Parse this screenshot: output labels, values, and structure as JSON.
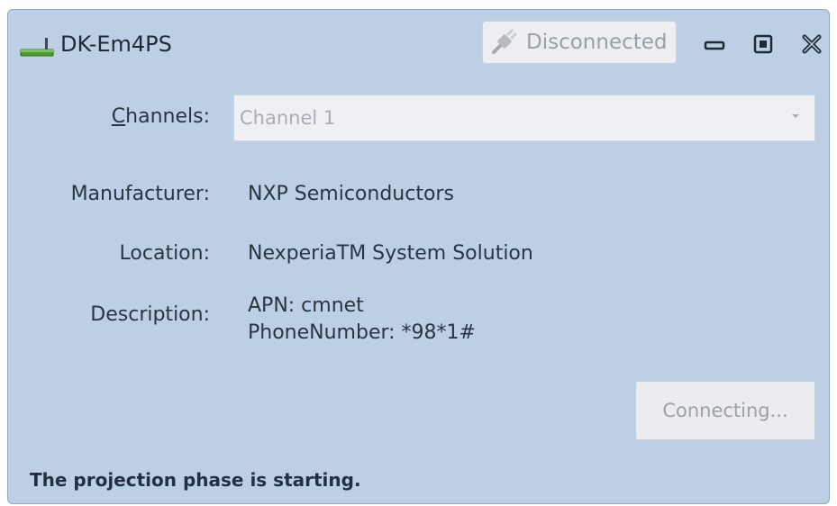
{
  "window": {
    "title": "DK-Em4PS",
    "connection_status": "Disconnected"
  },
  "form": {
    "channels": {
      "label_accel": "C",
      "label_rest": "hannels:",
      "selected": "Channel 1"
    },
    "manufacturer": {
      "label": "Manufacturer:",
      "value": "NXP Semiconductors"
    },
    "location": {
      "label": "Location:",
      "value": "NexperiaTM System Solution"
    },
    "description": {
      "label": "Description:",
      "line1": "APN: cmnet",
      "line2": "PhoneNumber: *98*1#"
    }
  },
  "actions": {
    "connect_label": "Connecting..."
  },
  "status_bar": {
    "message": "The projection phase is starting."
  },
  "colors": {
    "window_bg": "#bccfe5",
    "disabled_text": "#9ba1a9",
    "text": "#2a3544"
  },
  "icons": {
    "app": "device-icon",
    "status": "plug-icon",
    "minimize": "minimize-icon",
    "maximize": "maximize-icon",
    "close": "close-icon",
    "dropdown": "chevron-down-icon"
  }
}
